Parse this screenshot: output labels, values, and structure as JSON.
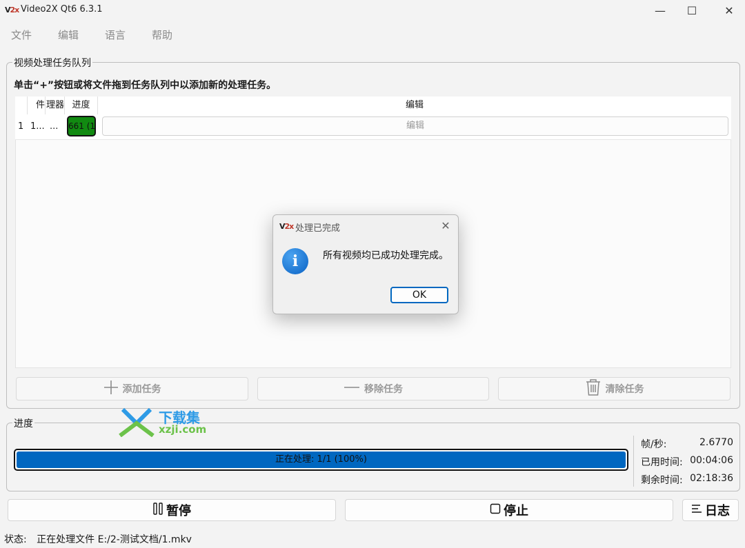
{
  "window": {
    "logo_text": "V",
    "logo_accent": "2x",
    "title": "Video2X Qt6 6.3.1",
    "minimize_glyph": "—",
    "maximize_glyph": "☐",
    "close_glyph": "✕"
  },
  "menu": {
    "items": [
      "文件",
      "编辑",
      "语言",
      "帮助"
    ]
  },
  "queue": {
    "group_title": "视频处理任务队列",
    "hint": "单击“+”按钮或将文件拖到任务队列中以添加新的处理任务。",
    "columns": [
      "",
      "件",
      "理器",
      "进度",
      "编辑"
    ],
    "rows": [
      {
        "index": "1",
        "file": "1...",
        "processor": "...",
        "progress_text": "661 (1",
        "edit_label": "编辑"
      }
    ],
    "buttons": {
      "add": "添加任务",
      "remove": "移除任务",
      "clear": "清除任务"
    }
  },
  "progress": {
    "group_title": "进度",
    "bar_text": "正在处理: 1/1 (100%)",
    "bar_fraction": 1.0,
    "stats": [
      {
        "label": "帧/秒:",
        "value": "2.6770"
      },
      {
        "label": "已用时间:",
        "value": "00:04:06"
      },
      {
        "label": "剩余时间:",
        "value": "02:18:36"
      }
    ]
  },
  "controls": {
    "pause": "暂停",
    "stop": "停止",
    "log": "日志"
  },
  "status": {
    "label": "状态:",
    "text": "正在处理文件 E:/2-测试文档/1.mkv"
  },
  "watermark": {
    "brand": "下载集",
    "domain": "xzji.com"
  },
  "dialog": {
    "title": "处理已完成",
    "message": "所有视频均已成功处理完成。",
    "ok_label": "OK",
    "close_glyph": "✕"
  },
  "colors": {
    "accent": "#0067c0",
    "progress_cell": "#118a11",
    "window_bg": "#f3f3f3"
  }
}
